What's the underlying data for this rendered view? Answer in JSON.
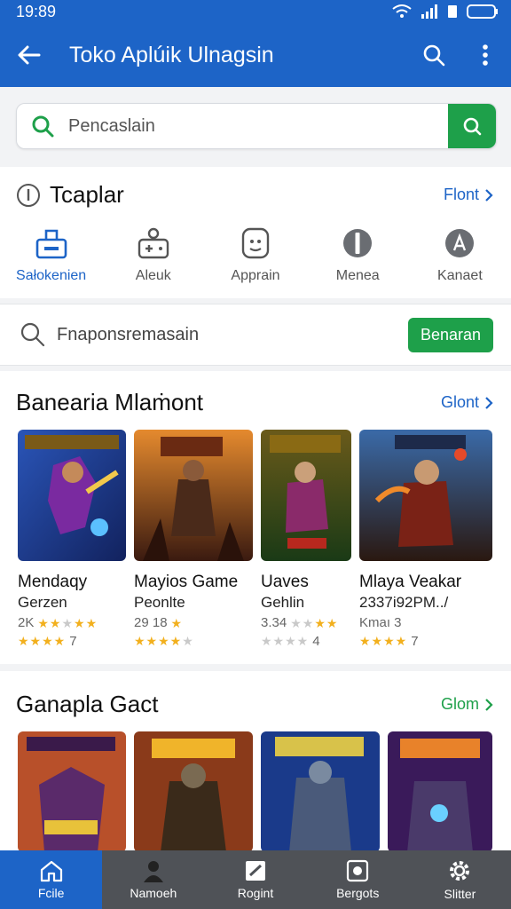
{
  "status": {
    "time": "19:89"
  },
  "appbar": {
    "title": "Toko Aplúik Ulnagsin"
  },
  "search": {
    "placeholder": "Pencaslain"
  },
  "categories": {
    "title": "Tcaplar",
    "more": "Flont",
    "items": [
      {
        "label": "Sałokenien",
        "icon": "tag-icon"
      },
      {
        "label": "Aleuk",
        "icon": "gamepad-icon"
      },
      {
        "label": "Apprain",
        "icon": "app-icon"
      },
      {
        "label": "Menea",
        "icon": "media-icon"
      },
      {
        "label": "Kanaet",
        "icon": "kanaet-icon"
      }
    ]
  },
  "promo": {
    "text": "Fnaponsremasain",
    "button": "Benaran"
  },
  "featured": {
    "title": "Banearia Mlaṁont",
    "more": "Glont",
    "games": [
      {
        "name": "Mendaqy",
        "sub": "Gerzen",
        "meta": "2K",
        "rating": "7",
        "stars1": 3,
        "stars2": 4
      },
      {
        "name": "Mayios Game",
        "sub": "Peonlte",
        "meta": "29 18",
        "rating": "",
        "stars1": 1,
        "stars2": 4
      },
      {
        "name": "Uaves",
        "sub": "Gehlin",
        "meta": "3.34",
        "rating": "4",
        "stars1": 2,
        "stars2": 4
      },
      {
        "name": "Mlaya Veakar",
        "sub": "2337i92PM../",
        "meta": "Kmaı 3",
        "rating": "7",
        "stars1": 0,
        "stars2": 4
      }
    ]
  },
  "section2": {
    "title": "Ganapla Gact",
    "more": "Glom"
  },
  "nav": [
    {
      "label": "Fcile",
      "icon": "home-icon"
    },
    {
      "label": "Namoeh",
      "icon": "person-icon"
    },
    {
      "label": "Rogint",
      "icon": "game-icon"
    },
    {
      "label": "Bergots",
      "icon": "device-icon"
    },
    {
      "label": "Slitter",
      "icon": "settings-icon"
    }
  ],
  "colors": {
    "primary": "#1d64c7",
    "accent": "#1ea04a",
    "nav": "#4f5257"
  }
}
